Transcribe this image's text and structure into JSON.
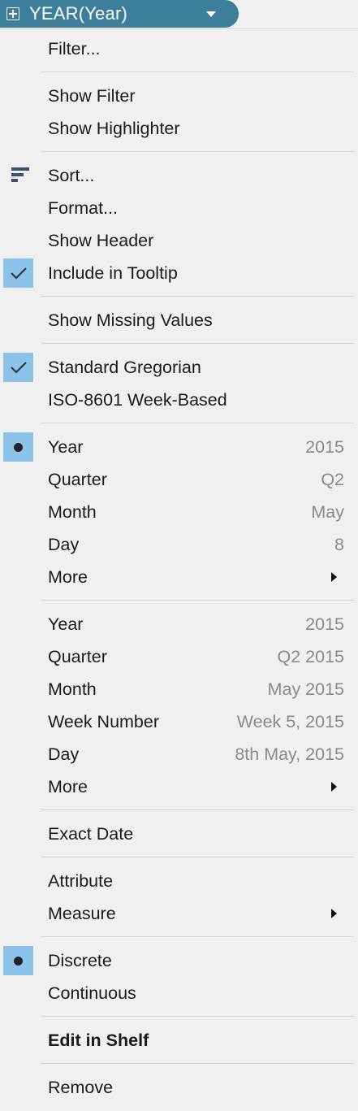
{
  "pill": {
    "title": "YEAR(Year)",
    "color": "#3c7f9b"
  },
  "menu": {
    "filter": "Filter...",
    "show_filter": "Show Filter",
    "show_highlighter": "Show Highlighter",
    "sort": "Sort...",
    "format": "Format...",
    "show_header": "Show Header",
    "include_tooltip": "Include in Tooltip",
    "show_missing": "Show Missing Values",
    "standard_gregorian": "Standard Gregorian",
    "iso_week": "ISO-8601 Week-Based",
    "date_parts": [
      {
        "label": "Year",
        "value": "2015"
      },
      {
        "label": "Quarter",
        "value": "Q2"
      },
      {
        "label": "Month",
        "value": "May"
      },
      {
        "label": "Day",
        "value": "8"
      },
      {
        "label": "More",
        "value": ""
      }
    ],
    "date_values": [
      {
        "label": "Year",
        "value": "2015"
      },
      {
        "label": "Quarter",
        "value": "Q2 2015"
      },
      {
        "label": "Month",
        "value": "May 2015"
      },
      {
        "label": "Week Number",
        "value": "Week 5, 2015"
      },
      {
        "label": "Day",
        "value": "8th May, 2015"
      },
      {
        "label": "More",
        "value": ""
      }
    ],
    "exact_date": "Exact Date",
    "attribute": "Attribute",
    "measure": "Measure",
    "discrete": "Discrete",
    "continuous": "Continuous",
    "edit_in_shelf": "Edit in Shelf",
    "remove": "Remove",
    "selection_color": "#8cc3ea"
  }
}
